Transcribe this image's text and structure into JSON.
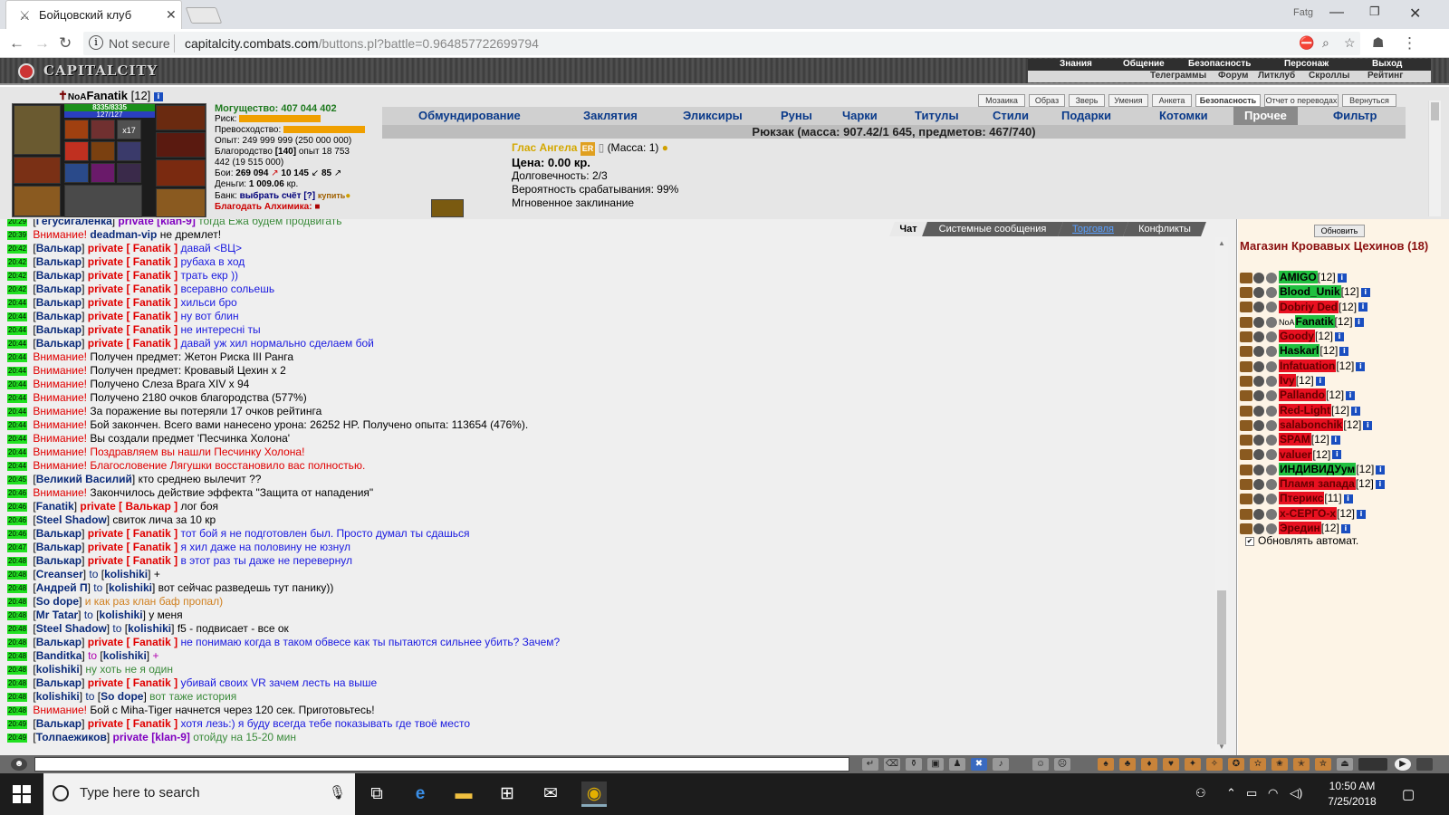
{
  "browser": {
    "tab_title": "Бойцовский клуб",
    "profile": "Fatg",
    "not_secure": "Not secure",
    "url_host": "capitalcity.combats.com",
    "url_path": "/buttons.pl?battle=0.964857722699794"
  },
  "game": {
    "logo": "CAPITALCITY",
    "top_nav_row1": [
      "Знания",
      "Общение",
      "Безопасность",
      "Персонаж",
      "Выход"
    ],
    "top_nav_row2": [
      "Телеграммы",
      "Форум",
      "Литклуб",
      "Скроллы",
      "Рейтинг"
    ]
  },
  "character": {
    "clan_prefix": "NoA",
    "name": "Fanatik",
    "level": "[12]",
    "hp": "8335/8335",
    "mana": "127/127",
    "item_count_badge": "x17",
    "might": "Могущество: 407 044 402",
    "risk_label": "Риск:",
    "superiority_label": "Превосходство:",
    "experience": "Опыт: 249 999 999 (250 000 000)",
    "charity_label": "Благородство",
    "charity_level": "[140]",
    "charity_exp": "опыт 18 753",
    "charity_sub": "442 (19 515 000)",
    "battles_label": "Бои:",
    "wins": "269 094",
    "losses": "10 145",
    "draws": "85",
    "money_label": "Деньги:",
    "money": "1 009.06",
    "money_unit": "кр.",
    "bank_label": "Банк:",
    "bank_link": "выбрать счёт",
    "bank_help": "[?]",
    "bank_buy": "купить",
    "alchemist": "Благодать Алхимика:"
  },
  "toolbar_buttons": [
    "Мозаика",
    "Образ",
    "Зверь",
    "Умения",
    "Анкета",
    "Безопасность",
    "Отчет о переводах",
    "Вернуться"
  ],
  "inventory_tabs": [
    "Обмундирование",
    "Заклятия",
    "Эликсиры",
    "Руны",
    "Чарки",
    "Титулы",
    "Стили",
    "Подарки",
    "Котомки",
    "Прочее",
    "Фильтр"
  ],
  "backpack_title": "Рюкзак (масса: 907.42/1 645, предметов: 467/740)",
  "item": {
    "name": "Глас Ангела",
    "badge": "ER",
    "mass": "(Масса: 1)",
    "price": "Цена: 0.00 кр.",
    "durability": "Долговечность: 2/3",
    "chance": "Вероятность срабатывания: 99%",
    "type": "Мгновенное заклинание"
  },
  "chat_tabs": [
    "Чат",
    "Системные сообщения",
    "Торговля",
    "Конфликты"
  ],
  "chat_lines": [
    {
      "t": "20:29",
      "nick": "Гегусигаленка",
      "kind": "pv",
      "target": "klan-9",
      "msg": "тогда Ежа будем продвигать",
      "mc": "mg"
    },
    {
      "t": "20:39",
      "kind": "warn",
      "nick2": "deadman-vip",
      "msg": "не дремлет!"
    },
    {
      "t": "20:42",
      "nick": "Валькар",
      "kind": "pvr",
      "target": "Fanatik",
      "msg": "давай <ВЦ>",
      "mc": "mb"
    },
    {
      "t": "20:42",
      "nick": "Валькар",
      "kind": "pvr",
      "target": "Fanatik",
      "msg": "рубаха в ход",
      "mc": "mb"
    },
    {
      "t": "20:42",
      "nick": "Валькар",
      "kind": "pvr",
      "target": "Fanatik",
      "msg": "трать екр ))",
      "mc": "mb"
    },
    {
      "t": "20:42",
      "nick": "Валькар",
      "kind": "pvr",
      "target": "Fanatik",
      "msg": "всеравно сольешь",
      "mc": "mb"
    },
    {
      "t": "20:44",
      "nick": "Валькар",
      "kind": "pvr",
      "target": "Fanatik",
      "msg": "хильси бро",
      "mc": "mb"
    },
    {
      "t": "20:44",
      "nick": "Валькар",
      "kind": "pvr",
      "target": "Fanatik",
      "msg": "ну вот блин",
      "mc": "mb"
    },
    {
      "t": "20:44",
      "nick": "Валькар",
      "kind": "pvr",
      "target": "Fanatik",
      "msg": "не интересні ты",
      "mc": "mb"
    },
    {
      "t": "20:44",
      "nick": "Валькар",
      "kind": "pvr",
      "target": "Fanatik",
      "msg": "давай уж хил нормально сделаем бой",
      "mc": "mb"
    },
    {
      "t": "20:44",
      "kind": "warn",
      "msg": "Получен предмет: Жетон Риска III Ранга",
      "mc": "ma"
    },
    {
      "t": "20:44",
      "kind": "warn",
      "msg": "Получен предмет: Кровавый Цехин x 2",
      "mc": "ma"
    },
    {
      "t": "20:44",
      "kind": "warn",
      "msg": "Получено Слеза Врага XIV x 94",
      "mc": "ma"
    },
    {
      "t": "20:44",
      "kind": "warn",
      "msg": "Получено 2180 очков благородства (577%)",
      "mc": "ma"
    },
    {
      "t": "20:44",
      "kind": "warn",
      "msg": "За поражение вы потеряли 17 очков рейтинга",
      "mc": "ma"
    },
    {
      "t": "20:44",
      "kind": "warn",
      "msg": "Бой закончен. Всего вами нанесено урона: 26252 HP. Получено опыта: 113654 (476%).",
      "mc": "ma"
    },
    {
      "t": "20:44",
      "kind": "warn",
      "msg": "Вы создали предмет 'Песчинка Холона'",
      "mc": "ma"
    },
    {
      "t": "20:44",
      "kind": "warn",
      "msg": "Поздравляем вы нашли Песчинку Холона!",
      "mc": "mr"
    },
    {
      "t": "20:44",
      "kind": "warn",
      "msg": "Благословение Лягушки восстановило вас полностью.",
      "mc": "mr"
    },
    {
      "t": "20:45",
      "nick": "Великий Василий",
      "kind": "plain",
      "msg": "кто среднею вылечит ??",
      "mc": "ma"
    },
    {
      "t": "20:46",
      "kind": "warn",
      "msg": "Закончилось действие эффекта \"Защита от нападения\"",
      "mc": "ma"
    },
    {
      "t": "20:46",
      "nick": "Fanatik",
      "kind": "pvr",
      "target": "Валькар",
      "msg": "лог боя",
      "mc": "ma"
    },
    {
      "t": "20:46",
      "nick": "Steel Shadow",
      "kind": "plain",
      "msg": "свиток лича за 10 кр",
      "mc": "ma"
    },
    {
      "t": "20:46",
      "nick": "Валькар",
      "kind": "pvr",
      "target": "Fanatik",
      "msg": "тот бой я не подготовлен был. Просто думал ты сдашься",
      "mc": "mb"
    },
    {
      "t": "20:47",
      "nick": "Валькар",
      "kind": "pvr",
      "target": "Fanatik",
      "msg": "я хил даже на половину не юзнул",
      "mc": "mb"
    },
    {
      "t": "20:48",
      "nick": "Валькар",
      "kind": "pvr",
      "target": "Fanatik",
      "msg": "в этот раз ты даже не перевернул",
      "mc": "mb"
    },
    {
      "t": "20:48",
      "nick": "Creanser",
      "kind": "to",
      "target": "kolishiki",
      "msg": "+",
      "mc": "ma"
    },
    {
      "t": "20:48",
      "nick": "Андрей П",
      "kind": "to",
      "target": "kolishiki",
      "msg": "вот сейчас разведешь тут панику))",
      "mc": "ma"
    },
    {
      "t": "20:48",
      "nick": "So dope",
      "kind": "plain",
      "msg": "и как раз клан баф пропал)",
      "mc": "mo"
    },
    {
      "t": "20:48",
      "nick": "Mr Tatar",
      "kind": "to",
      "target": "kolishiki",
      "msg": "у меня",
      "mc": "ma"
    },
    {
      "t": "20:48",
      "nick": "Steel Shadow",
      "kind": "to",
      "target": "kolishiki",
      "msg": "f5 - подвисает - все ок",
      "mc": "ma"
    },
    {
      "t": "20:48",
      "nick": "Валькар",
      "kind": "pvr",
      "target": "Fanatik",
      "msg": "не понимаю когда в таком обвесе как ты пытаются сильнее убить? Зачем?",
      "mc": "mb"
    },
    {
      "t": "20:48",
      "nick": "Banditka",
      "kind": "top",
      "target": "kolishiki",
      "msg": "+",
      "mc": "mp"
    },
    {
      "t": "20:48",
      "nick": "kolishiki",
      "kind": "plain",
      "msg": "ну хоть не я один",
      "mc": "mg"
    },
    {
      "t": "20:48",
      "nick": "Валькар",
      "kind": "pvr",
      "target": "Fanatik",
      "msg": "убивай своих VR зачем лесть на выше",
      "mc": "mb"
    },
    {
      "t": "20:48",
      "nick": "kolishiki",
      "kind": "to",
      "target": "So dope",
      "msg": "вот таже история",
      "mc": "mg"
    },
    {
      "t": "20:48",
      "kind": "warn",
      "msg": "Бой с Miha-Tiger начнется через 120 сек. Приготовьтесь!",
      "mc": "ma"
    },
    {
      "t": "20:49",
      "nick": "Валькар",
      "kind": "pvr",
      "target": "Fanatik",
      "msg": "хотя лезь:) я буду всегда тебе показывать где твоё место",
      "mc": "mb"
    },
    {
      "t": "20:49",
      "nick": "Толпаежиков",
      "kind": "pv",
      "target": "klan-9",
      "msg": "отойду на 15-20 мин",
      "mc": "mg"
    }
  ],
  "labels": {
    "warn": "Внимание!",
    "private": "private",
    "to": "to"
  },
  "shop": {
    "refresh": "Обновить",
    "title": "Магазин Кровавых Цехинов (18)",
    "players": [
      {
        "name": "AMIGO",
        "lvl": "[12]",
        "c": "g"
      },
      {
        "name": "Blood_Unik",
        "lvl": "[12]",
        "c": "g"
      },
      {
        "name": "Dobriy Ded",
        "lvl": "[12]",
        "c": "r"
      },
      {
        "name": "Fanatik",
        "lvl": "[12]",
        "c": "g",
        "prefix": "NoA"
      },
      {
        "name": "Goody",
        "lvl": "[12]",
        "c": "r"
      },
      {
        "name": "Haskarl",
        "lvl": "[12]",
        "c": "g"
      },
      {
        "name": "Infatuation",
        "lvl": "[12]",
        "c": "r"
      },
      {
        "name": "Ivy",
        "lvl": "[12]",
        "c": "r"
      },
      {
        "name": "Pallando",
        "lvl": "[12]",
        "c": "r"
      },
      {
        "name": "Red-Light",
        "lvl": "[12]",
        "c": "r"
      },
      {
        "name": "salabonchik",
        "lvl": "[12]",
        "c": "r"
      },
      {
        "name": "SPAM",
        "lvl": "[12]",
        "c": "r"
      },
      {
        "name": "valuer",
        "lvl": "[12]",
        "c": "r"
      },
      {
        "name": "ИНДИВИДУум",
        "lvl": "[12]",
        "c": "g"
      },
      {
        "name": "Пламя запада",
        "lvl": "[12]",
        "c": "r"
      },
      {
        "name": "Птерикс",
        "lvl": "[11]",
        "c": "r"
      },
      {
        "name": "х-СЕРГО-х",
        "lvl": "[12]",
        "c": "r"
      },
      {
        "name": "Эредин",
        "lvl": "[12]",
        "c": "r"
      }
    ],
    "auto_refresh": "Обновлять автомат."
  },
  "taskbar": {
    "search_placeholder": "Type here to search",
    "time": "10:50 AM",
    "date": "7/25/2018"
  }
}
